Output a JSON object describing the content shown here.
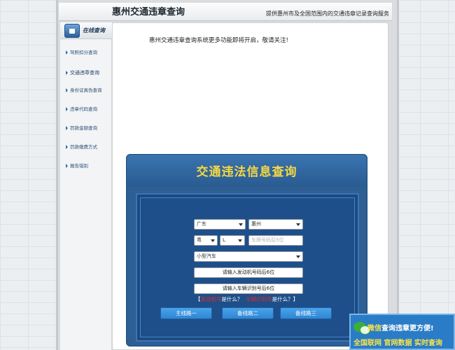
{
  "header": {
    "title": "惠州交通违章查询",
    "tagline": "提供惠州市及全国范围内的交通违章记录查询服务"
  },
  "sidebar": {
    "heading": "在线查询",
    "items": [
      {
        "label": "驾照扣分查询"
      },
      {
        "label": "交通违章查询"
      },
      {
        "label": "身份证真伪查询"
      },
      {
        "label": "违章代码查询"
      },
      {
        "label": "罚款金额查询"
      },
      {
        "label": "罚款缴费方式"
      },
      {
        "label": "报告错别"
      }
    ]
  },
  "notice": "惠州交通违章查询系统更多功能即将开启，敬请关注!",
  "query_panel": {
    "title": "交通违法信息查询",
    "province": "广东",
    "city": "惠州",
    "plate_prefix": "粤",
    "plate_letter": "L",
    "plate_placeholder": "车牌号码后5位",
    "vehicle_type": "小型汽车",
    "engine_field": "请输入发动机号码后6位",
    "vin_field": "请输入车辆识别号后6位",
    "help": {
      "open_bracket": "【",
      "link1": "发动机号",
      "text1": "是什么？",
      "link2": "车辆识别号",
      "text2": "是什么？",
      "close_bracket": "】"
    },
    "buttons": {
      "main": "主线路一",
      "backup2": "备线路二",
      "backup3": "备线路三"
    }
  },
  "banner": {
    "line1_highlight": "微信",
    "line1_rest": "查询违章更方便!",
    "line2": "全国联网 官网数据 实时查询",
    "brand_color": "#2a7cc7"
  }
}
